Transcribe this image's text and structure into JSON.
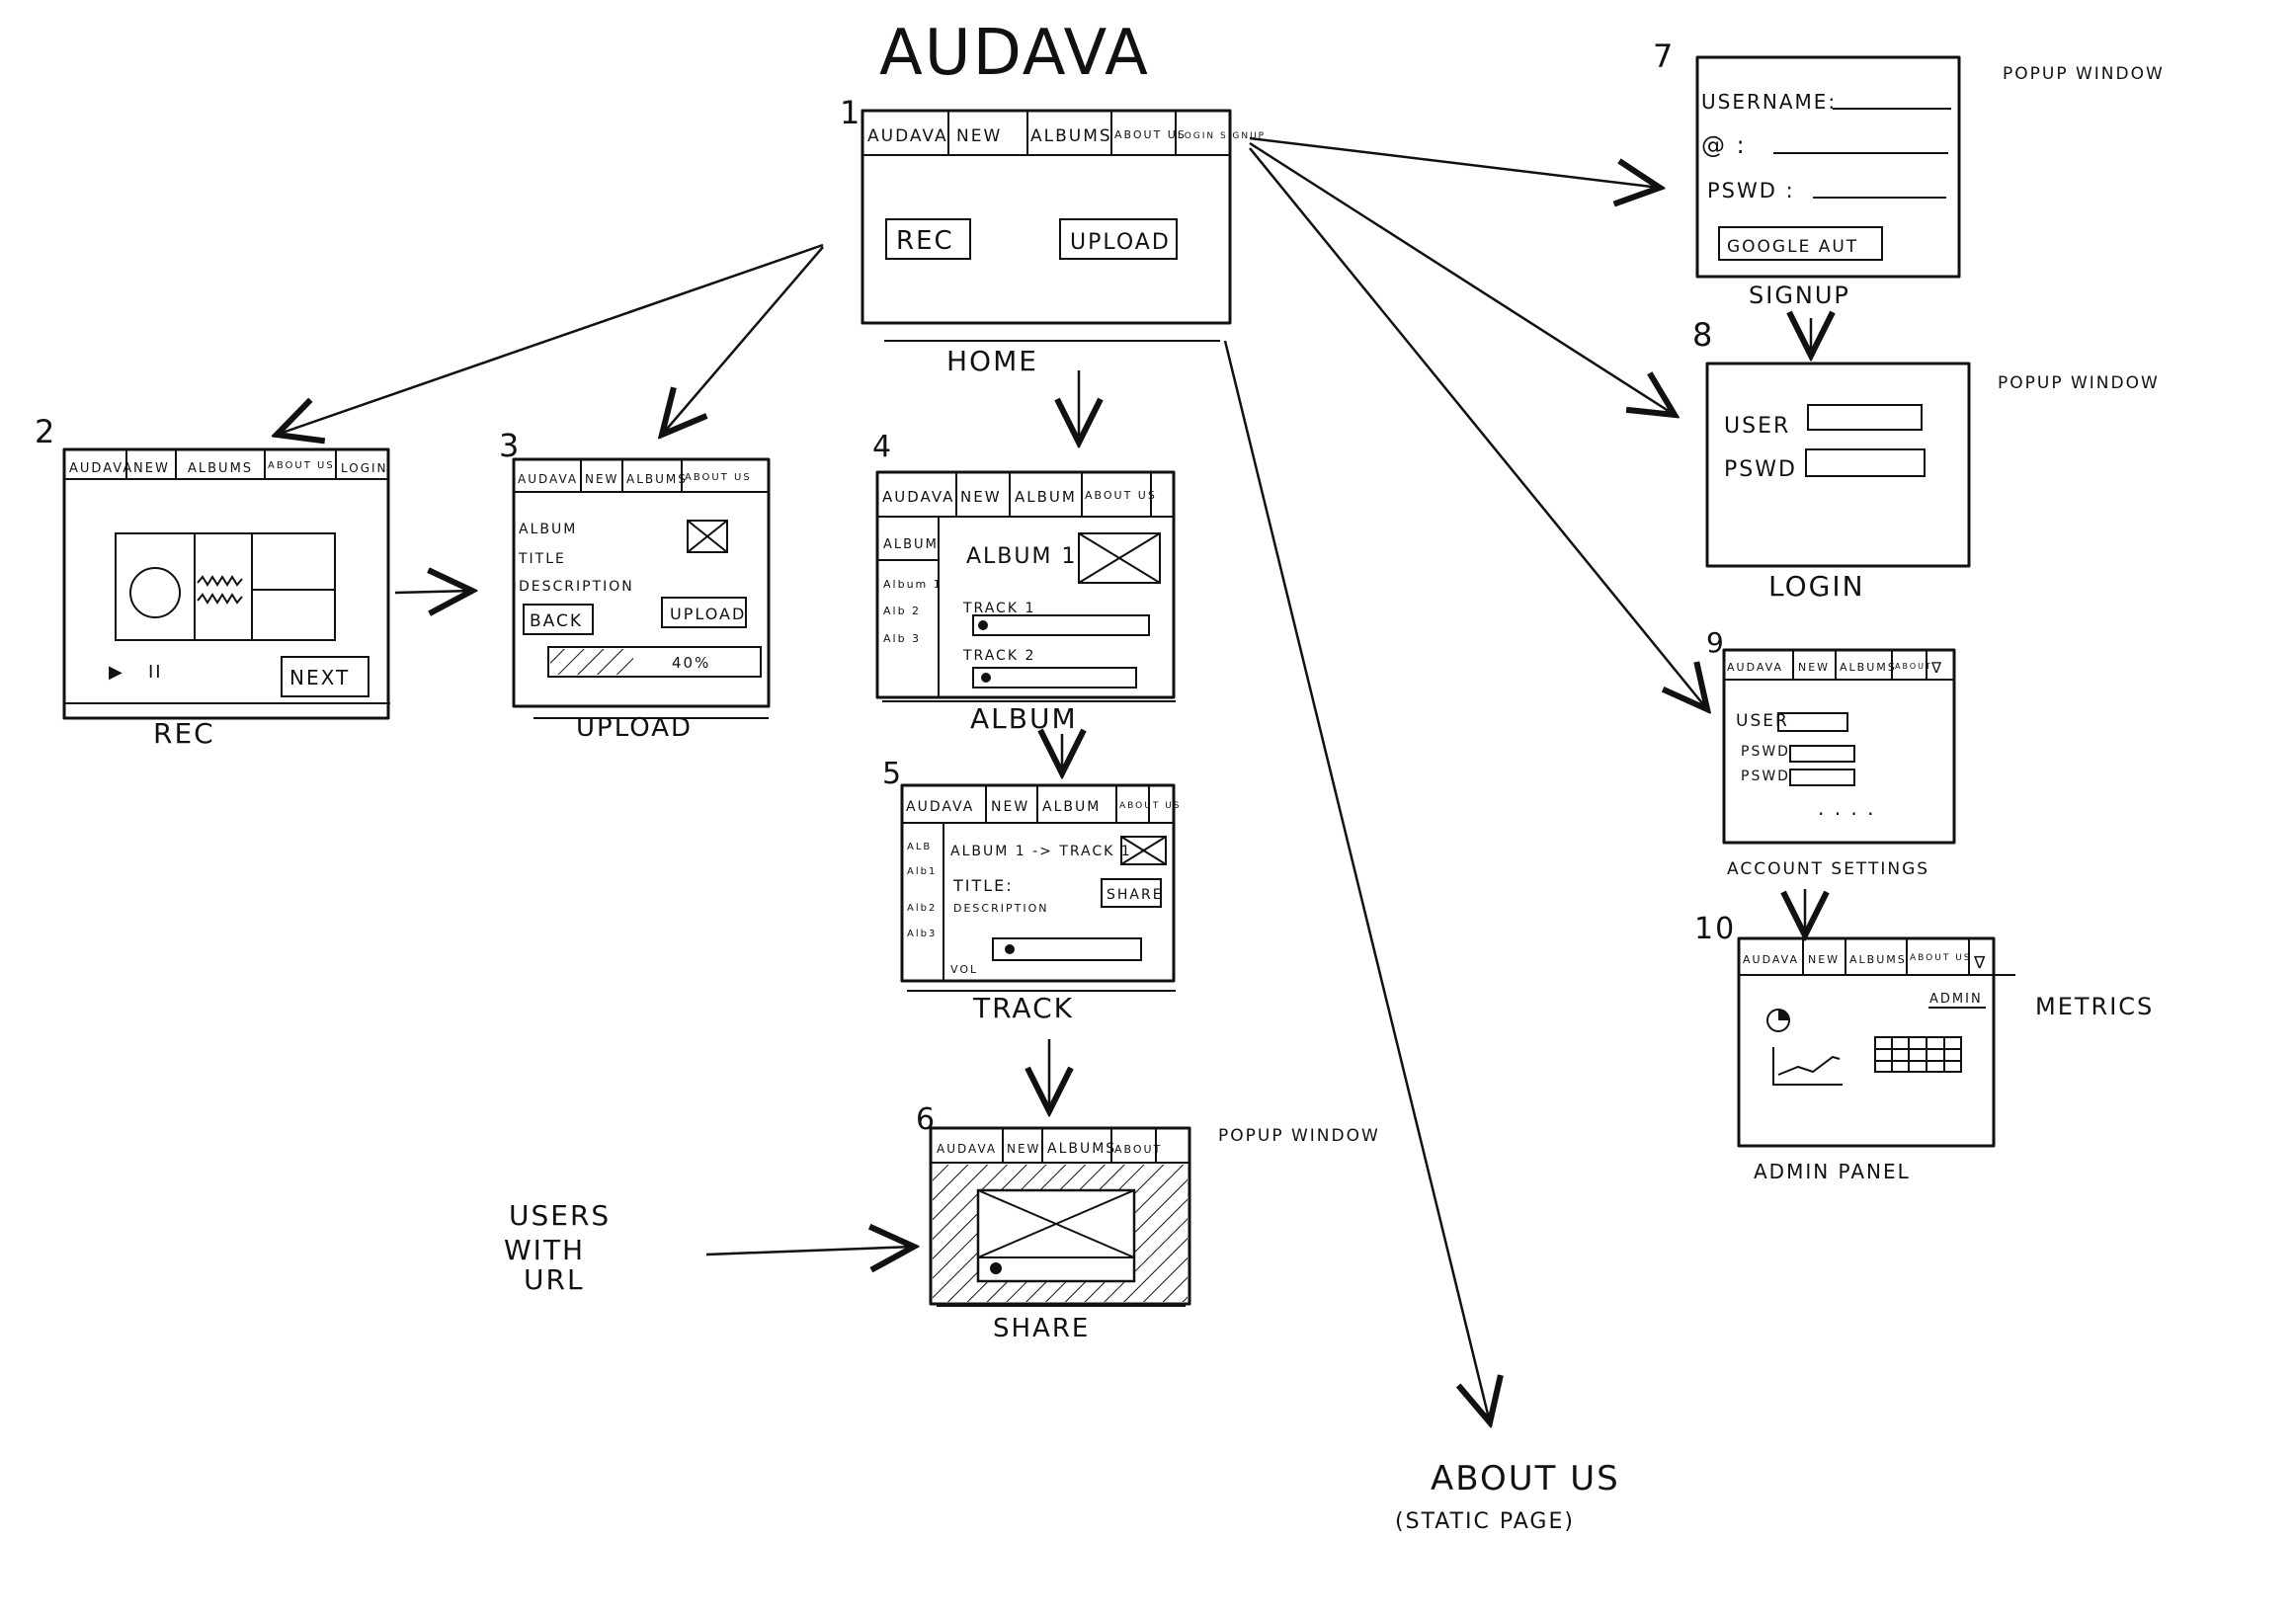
{
  "title": "AUDAVA",
  "screens": {
    "s1": {
      "number": "1",
      "label": "HOME",
      "nav": [
        "AUDAVA",
        "NEW",
        "ALBUMS",
        "ABOUT US",
        "LOGIN SIGNUP"
      ],
      "buttons": [
        "REC",
        "UPLOAD"
      ]
    },
    "s2": {
      "number": "2",
      "label": "REC",
      "nav": [
        "AUDAVA",
        "NEW",
        "ALBUMS",
        "ABOUT US",
        "LOGIN"
      ],
      "controls": [
        "▶",
        "II"
      ],
      "next": "NEXT"
    },
    "s3": {
      "number": "3",
      "label": "UPLOAD",
      "nav": [
        "AUDAVA",
        "NEW",
        "ALBUMS",
        "ABOUT US"
      ],
      "fields": [
        "ALBUM",
        "TITLE",
        "DESCRIPTION"
      ],
      "back": "BACK",
      "upload": "UPLOAD",
      "progress": "40%",
      "progress_value": 0.4
    },
    "s4": {
      "number": "4",
      "label": "ALBUM",
      "nav": [
        "AUDAVA",
        "NEW",
        "ALBUM",
        "ABOUT US"
      ],
      "sidebar": [
        "ALBUM",
        "Album 1",
        "Alb 2",
        "Alb 3"
      ],
      "heading": "ALBUM 1",
      "tracks": [
        "TRACK 1",
        "TRACK 2"
      ]
    },
    "s5": {
      "number": "5",
      "label": "TRACK",
      "nav": [
        "AUDAVA",
        "NEW",
        "ALBUM",
        "ABOUT US"
      ],
      "sidebar": [
        "ALB",
        "Alb1",
        "Alb2",
        "Alb3"
      ],
      "heading": "ALBUM 1 -> TRACK 1",
      "title_field": "TITLE:",
      "desc_field": "DESCRIPTION",
      "share": "SHARE",
      "vol": "VOL"
    },
    "s6": {
      "number": "6",
      "label": "SHARE",
      "nav": [
        "AUDAVA",
        "NEW",
        "ALBUMS",
        "ABOUT"
      ],
      "note": "POPUP WINDOW"
    },
    "s7": {
      "number": "7",
      "label": "SIGNUP",
      "note": "POPUP WINDOW",
      "fields": [
        "USERNAME:",
        "@ :",
        "PSWD :"
      ],
      "google": "GOOGLE AUT"
    },
    "s8": {
      "number": "8",
      "label": "LOGIN",
      "note": "POPUP WINDOW",
      "fields": [
        "USER",
        "PSWD"
      ]
    },
    "s9": {
      "number": "9",
      "label": "ACCOUNT SETTINGS",
      "nav": [
        "AUDAVA",
        "NEW",
        "ALBUMS",
        "ABOUT"
      ],
      "fields": [
        "USER",
        "PSWD",
        "PSWD"
      ],
      "ellipsis": ". . . ."
    },
    "s10": {
      "number": "10",
      "label": "ADMIN PANEL",
      "nav": [
        "AUDAVA",
        "NEW",
        "ALBUMS",
        "ABOUT US"
      ],
      "admin": "ADMIN",
      "note": "METRICS"
    }
  },
  "users_with_url": [
    "USERS",
    "WITH",
    "URL"
  ],
  "about": {
    "label": "ABOUT US",
    "sub": "(STATIC PAGE)"
  }
}
